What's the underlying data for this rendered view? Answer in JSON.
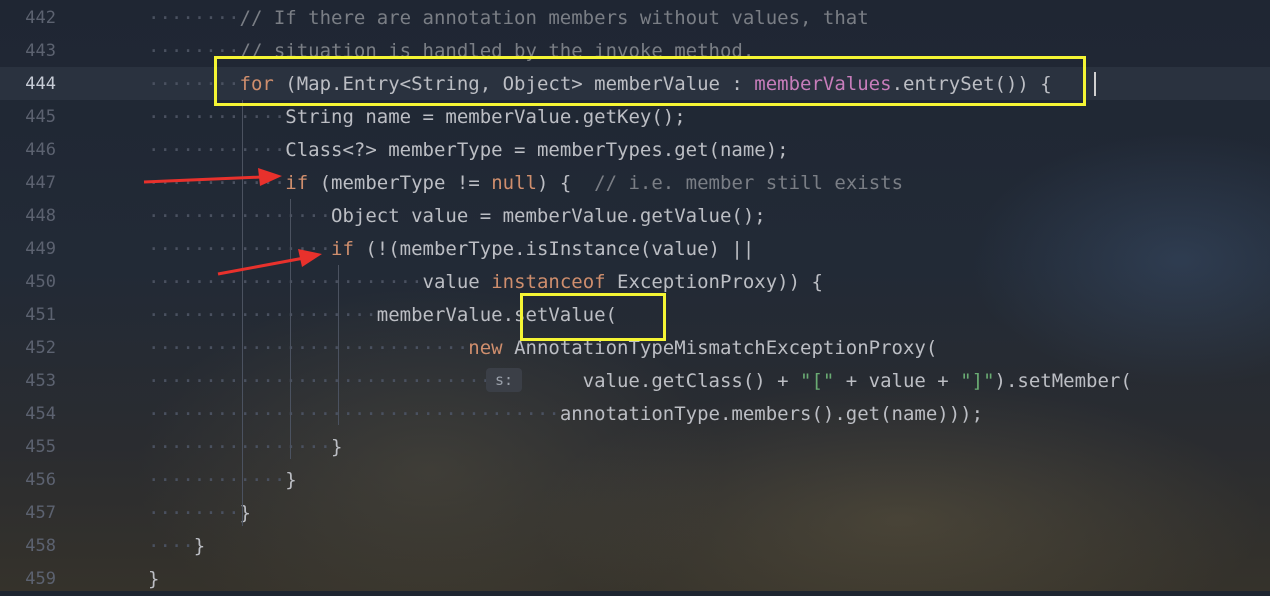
{
  "editor": {
    "lines": [
      {
        "num": "442",
        "indent": "········",
        "segs": [
          {
            "t": "// If there are annotation members without values, that",
            "c": "cm"
          }
        ]
      },
      {
        "num": "443",
        "indent": "········",
        "segs": [
          {
            "t": "// situation is handled by the invoke method.",
            "c": "cm"
          }
        ]
      },
      {
        "num": "444",
        "indent": "········",
        "segs": [
          {
            "t": "for",
            "c": "kw"
          },
          {
            "t": " (Map.Entry<String, Object> memberValue : ",
            "c": ""
          },
          {
            "t": "memberValues",
            "c": "fld"
          },
          {
            "t": ".entrySet()) {",
            "c": ""
          }
        ]
      },
      {
        "num": "445",
        "indent": "············",
        "segs": [
          {
            "t": "String name = memberValue.getKey();",
            "c": ""
          }
        ]
      },
      {
        "num": "446",
        "indent": "············",
        "segs": [
          {
            "t": "Class<?> memberType = memberTypes.get(name);",
            "c": ""
          }
        ]
      },
      {
        "num": "447",
        "indent": "············",
        "segs": [
          {
            "t": "if",
            "c": "kw"
          },
          {
            "t": " (memberType != ",
            "c": ""
          },
          {
            "t": "null",
            "c": "kw"
          },
          {
            "t": ") {  ",
            "c": ""
          },
          {
            "t": "// i.e. member still exists",
            "c": "cm"
          }
        ]
      },
      {
        "num": "448",
        "indent": "················",
        "segs": [
          {
            "t": "Object value = memberValue.getValue();",
            "c": ""
          }
        ]
      },
      {
        "num": "449",
        "indent": "················",
        "segs": [
          {
            "t": "if",
            "c": "kw"
          },
          {
            "t": " (!(memberType.isInstance(value) ||",
            "c": ""
          }
        ]
      },
      {
        "num": "450",
        "indent": "························",
        "segs": [
          {
            "t": "value ",
            "c": ""
          },
          {
            "t": "instanceof",
            "c": "kw"
          },
          {
            "t": " ExceptionProxy)) {",
            "c": ""
          }
        ]
      },
      {
        "num": "451",
        "indent": "····················",
        "segs": [
          {
            "t": "memberValue.setValue(",
            "c": ""
          }
        ]
      },
      {
        "num": "452",
        "indent": "····························",
        "segs": [
          {
            "t": "new",
            "c": "kw"
          },
          {
            "t": " AnnotationTypeMismatchExceptionProxy(",
            "c": ""
          }
        ]
      },
      {
        "num": "453",
        "indent": "································",
        "segs": [
          {
            "t": "      value.getClass() + ",
            "c": ""
          },
          {
            "t": "\"[\"",
            "c": "str"
          },
          {
            "t": " + value + ",
            "c": ""
          },
          {
            "t": "\"]\"",
            "c": "str"
          },
          {
            "t": ").setMember(",
            "c": ""
          }
        ]
      },
      {
        "num": "454",
        "indent": "····································",
        "segs": [
          {
            "t": "annotationType.members().get(name)));",
            "c": ""
          }
        ]
      },
      {
        "num": "455",
        "indent": "················",
        "segs": [
          {
            "t": "}",
            "c": ""
          }
        ]
      },
      {
        "num": "456",
        "indent": "············",
        "segs": [
          {
            "t": "}",
            "c": ""
          }
        ]
      },
      {
        "num": "457",
        "indent": "········",
        "segs": [
          {
            "t": "}",
            "c": ""
          }
        ]
      },
      {
        "num": "458",
        "indent": "····",
        "segs": [
          {
            "t": "}",
            "c": ""
          }
        ]
      },
      {
        "num": "459",
        "indent": "",
        "segs": [
          {
            "t": "}",
            "c": ""
          }
        ]
      }
    ],
    "current_line": "444",
    "param_hint": "s:"
  },
  "colors": {
    "highlight_box": "#f5f534",
    "arrow": "#e8312c",
    "keyword": "#cf8e6d",
    "field": "#c77dbb",
    "comment": "#7a7e85",
    "string": "#6aab73"
  },
  "annotations": {
    "boxes": [
      "for-loop-header",
      "setValue-call"
    ],
    "arrows": [
      "if-membertype-check",
      "if-isinstance-check"
    ]
  }
}
